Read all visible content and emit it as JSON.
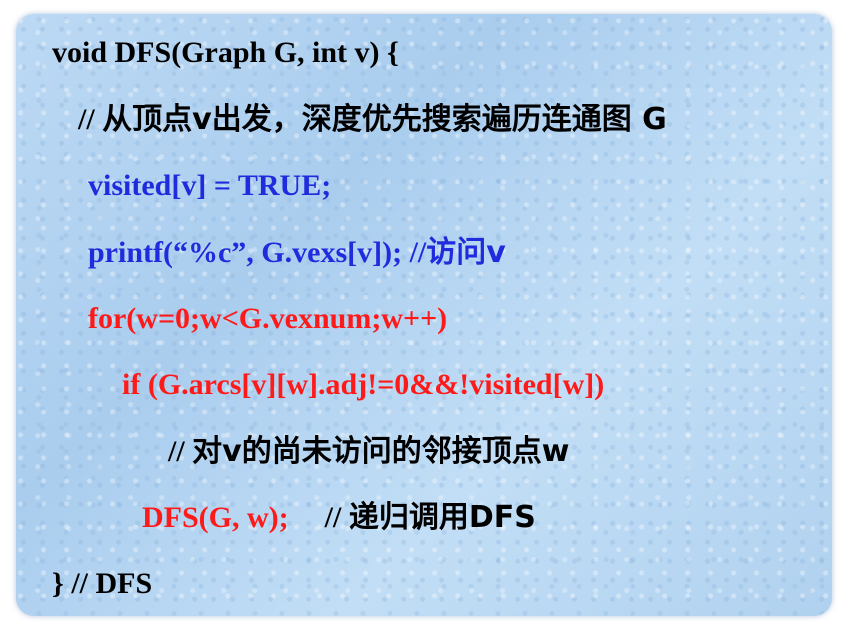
{
  "code": {
    "line1": "void DFS(Graph G, int v) {",
    "line2_comment": "// ",
    "line2_text": "从顶点v出发，深度优先搜索遍历连通图 G",
    "line3": "visited[v] = TRUE;",
    "line4_code": "printf(“%c”, G.vexs[v]); //",
    "line4_comment": "访问v",
    "line5": "for(w=0;w<G.vexnum;w++)",
    "line6": "if (G.arcs[v][w].adj!=0&&!visited[w])",
    "line7_prefix": "// ",
    "line7_text": "对v的尚未访问的邻接顶点w",
    "line8_call": "DFS(G, w);",
    "line8_comment_prefix": "// ",
    "line8_comment_text": "递归调用DFS",
    "line9": "} // DFS"
  },
  "colors": {
    "black": "#000000",
    "blue": "#1f2bdc",
    "red": "#ff1a1a",
    "background": "#b7d6f2"
  }
}
